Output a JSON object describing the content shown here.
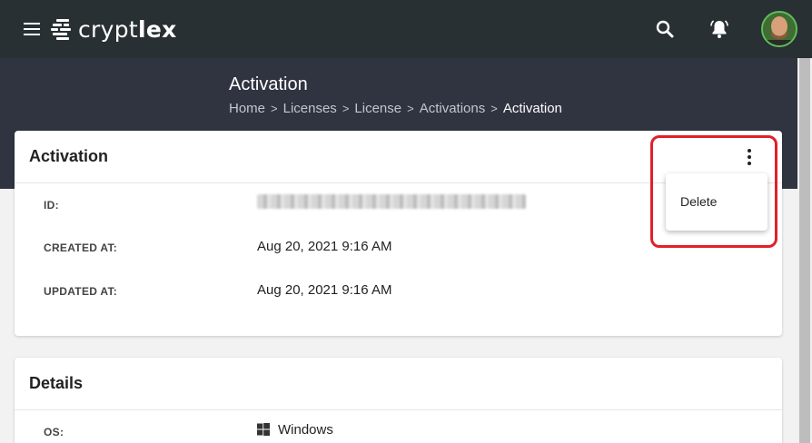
{
  "app": {
    "logo_regular": "crypt",
    "logo_bold": "lex"
  },
  "header": {
    "title": "Activation",
    "breadcrumb": [
      "Home",
      "Licenses",
      "License",
      "Activations",
      "Activation"
    ],
    "breadcrumb_separator": ">"
  },
  "activation_card": {
    "title": "Activation",
    "rows": [
      {
        "label": "ID:",
        "value": ""
      },
      {
        "label": "CREATED AT:",
        "value": "Aug 20, 2021 9:16 AM"
      },
      {
        "label": "UPDATED AT:",
        "value": "Aug 20, 2021 9:16 AM"
      }
    ]
  },
  "menu": {
    "items": [
      "Delete"
    ]
  },
  "details_card": {
    "title": "Details",
    "rows": [
      {
        "label": "OS:",
        "value": "Windows",
        "icon": "windows-icon"
      }
    ]
  },
  "colors": {
    "topbar": "#293034",
    "hero": "#303340",
    "highlight": "#e0202a",
    "avatar_ring": "#5fbe5a"
  },
  "icons": {
    "menu": "menu-icon",
    "search": "search-icon",
    "notifications": "bell-icon",
    "more": "more-vertical-icon",
    "os": "windows-icon"
  }
}
